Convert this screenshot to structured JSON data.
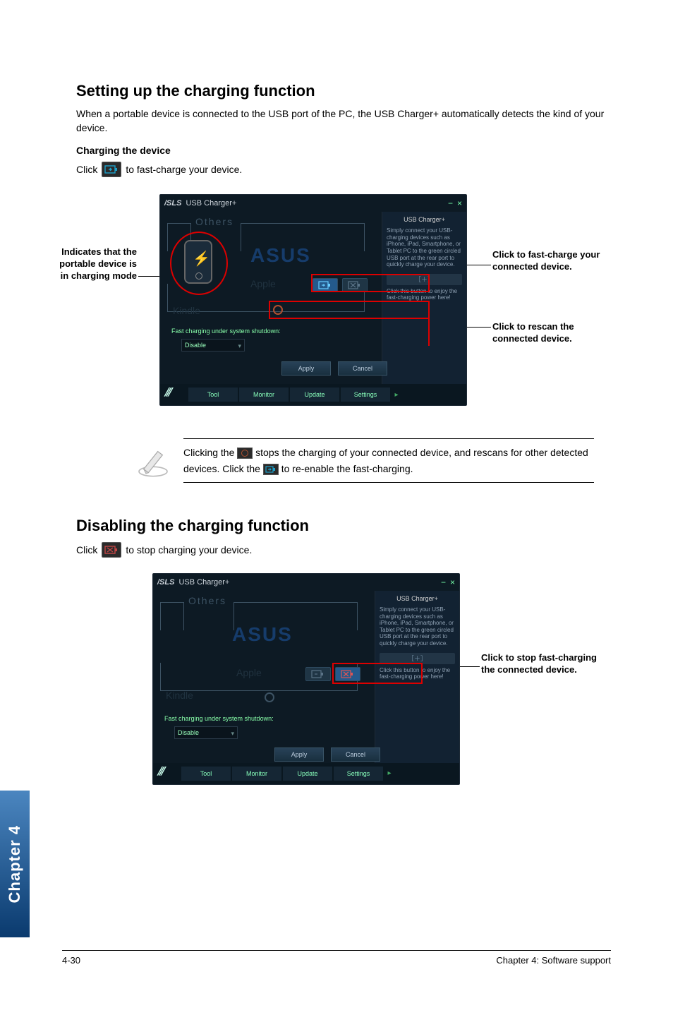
{
  "section1": {
    "heading": "Setting up the charging function",
    "intro": "When a portable device is connected to the USB port of the PC, the USB Charger+ automatically detects the kind of your device.",
    "subhead": "Charging the device",
    "click_pre": "Click",
    "click_post": "to fast-charge your device."
  },
  "figure1": {
    "callout_left": "Indicates that the portable device is in charging mode",
    "callout_right_top": "Click to fast-charge your connected device.",
    "callout_right_bot": "Click to rescan the connected device."
  },
  "app": {
    "title": "USB Charger+",
    "others_label": "Others",
    "brand": "ASUS",
    "ghost_apple": "Apple",
    "ghost_kindle": "Kindle",
    "fast_label": "Fast charging under system shutdown:",
    "dropdown": "Disable",
    "btn_apply": "Apply",
    "btn_cancel": "Cancel",
    "side_title": "USB Charger+",
    "side_text": "Simply connect your USB-charging devices such as iPhone, iPad, Smartphone, or Tablet PC to the green circled USB port at the rear port to quickly charge your device.",
    "side_text2": "Click this button to enjoy the fast-charging power here!",
    "side_btn": "+",
    "tabs": [
      "Tool",
      "Monitor",
      "Update",
      "Settings"
    ]
  },
  "note": {
    "text_a": "Clicking the ",
    "text_b": " stops the charging of your connected device, and rescans for other detected devices. Click the ",
    "text_c": " to re-enable the fast-charging."
  },
  "section2": {
    "heading": "Disabling the charging function",
    "click_pre": "Click",
    "click_post": "to stop charging your device.",
    "callout_right": "Click to stop fast-charging the connected device."
  },
  "chapter_tab": "Chapter 4",
  "footer": {
    "left": "4-30",
    "right": "Chapter 4: Software support"
  }
}
